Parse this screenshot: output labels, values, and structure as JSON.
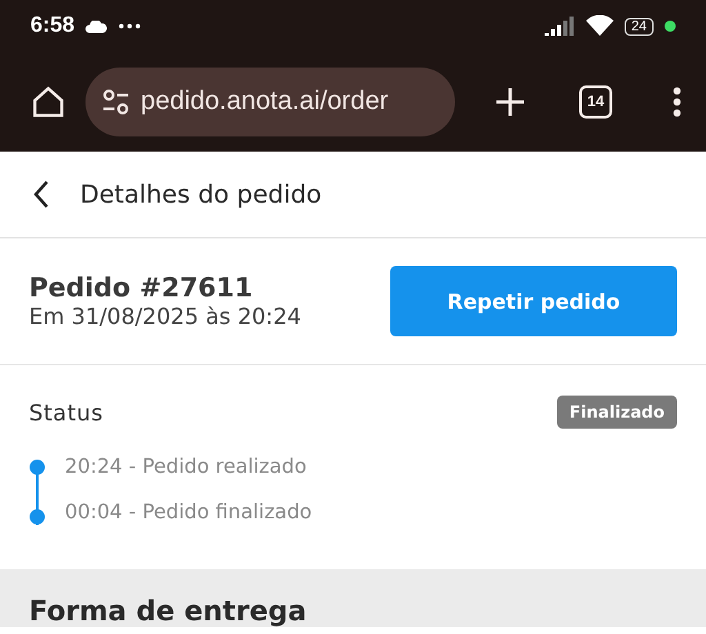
{
  "status_bar": {
    "time": "6:58",
    "battery": "24"
  },
  "browser": {
    "url": "pedido.anota.ai/order",
    "tab_count": "14"
  },
  "header": {
    "title": "Detalhes do pedido"
  },
  "order": {
    "title": "Pedido #27611",
    "date": "Em 31/08/2025 às 20:24",
    "button": "Repetir pedido"
  },
  "status": {
    "label": "Status",
    "badge": "Finalizado",
    "timeline": [
      {
        "text": "20:24 - Pedido realizado"
      },
      {
        "text": "00:04 - Pedido finalizado"
      }
    ]
  },
  "delivery": {
    "title": "Forma de entrega"
  }
}
